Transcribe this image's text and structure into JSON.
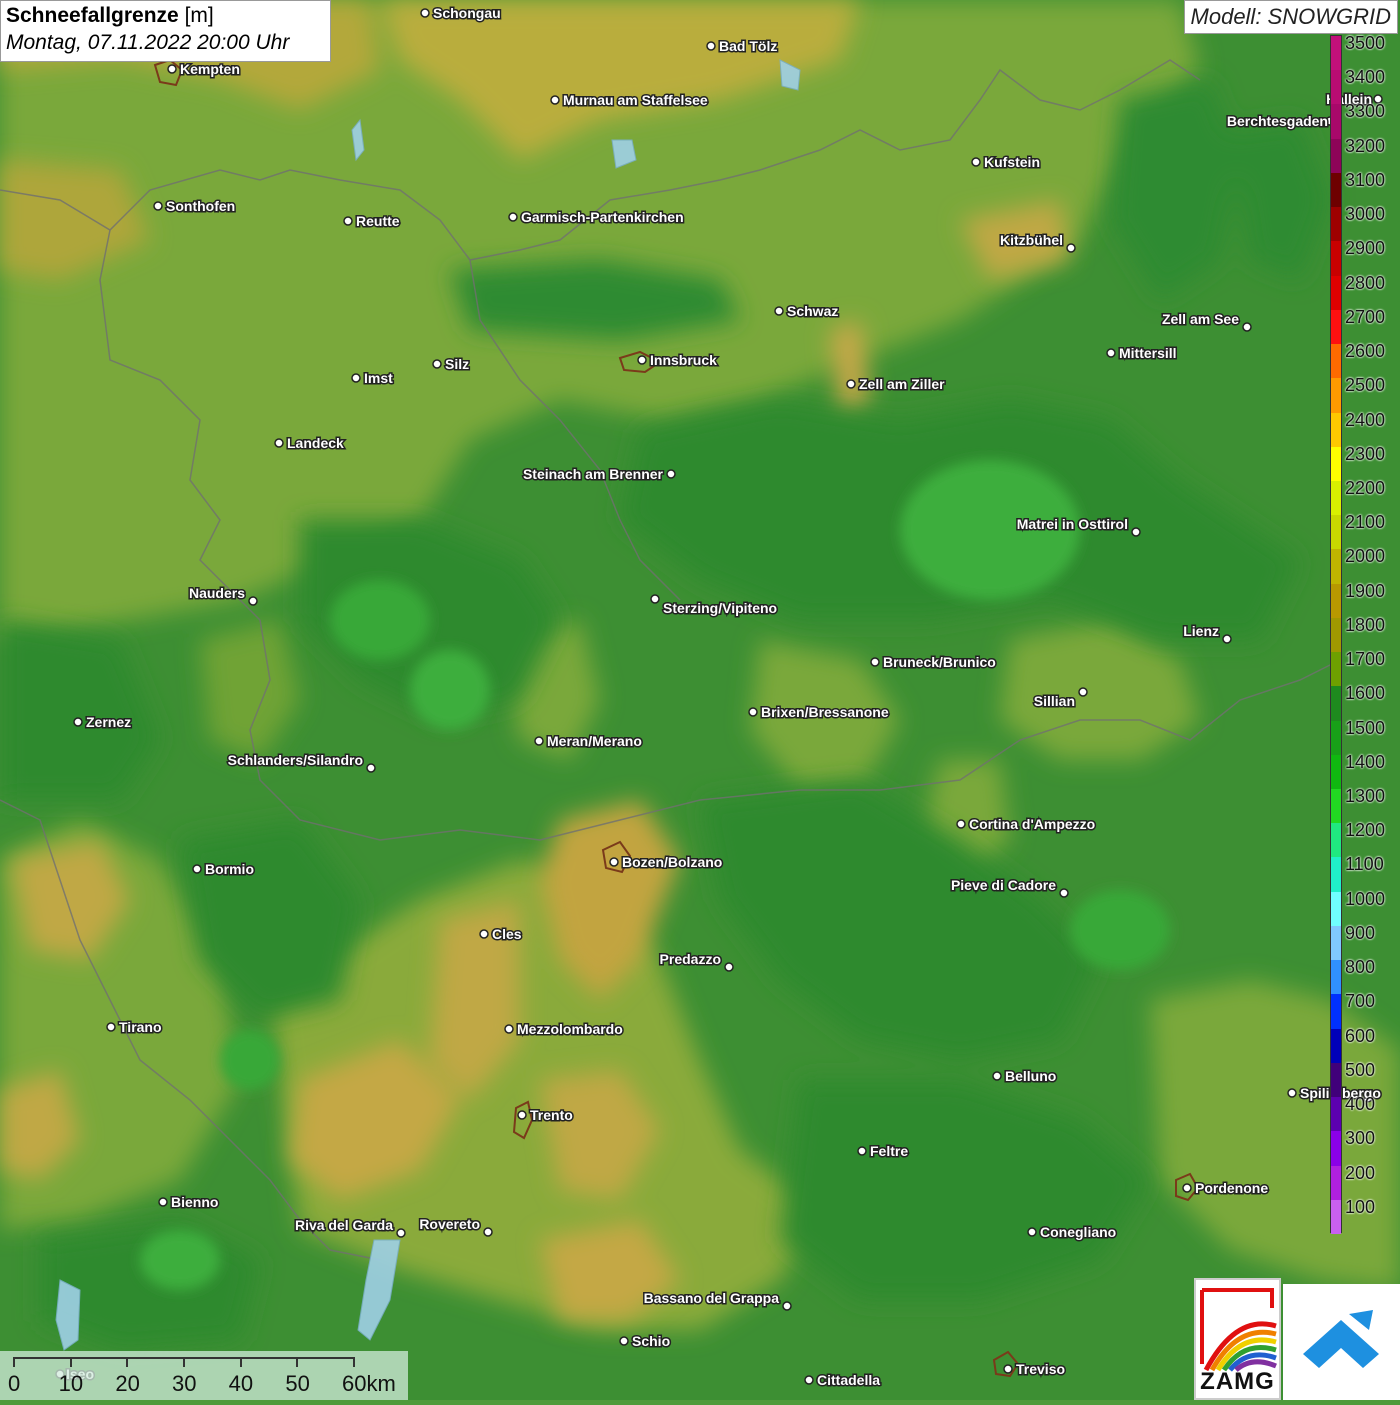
{
  "header": {
    "title": "Schneefallgrenze",
    "unit": "[m]",
    "subtitle": "Montag, 07.11.2022 20:00 Uhr",
    "model": "Modell: SNOWGRID"
  },
  "legend": {
    "items": [
      {
        "label": "3500",
        "color": "#c2107a"
      },
      {
        "label": "3400",
        "color": "#b80c72"
      },
      {
        "label": "3300",
        "color": "#a8086a"
      },
      {
        "label": "3200",
        "color": "#8e0458"
      },
      {
        "label": "3100",
        "color": "#6e0000"
      },
      {
        "label": "3000",
        "color": "#9e0000"
      },
      {
        "label": "2900",
        "color": "#c80000"
      },
      {
        "label": "2800",
        "color": "#e00000"
      },
      {
        "label": "2700",
        "color": "#ff1010"
      },
      {
        "label": "2600",
        "color": "#ff6a00"
      },
      {
        "label": "2500",
        "color": "#ff9a00"
      },
      {
        "label": "2400",
        "color": "#ffc800"
      },
      {
        "label": "2300",
        "color": "#ffff00"
      },
      {
        "label": "2200",
        "color": "#d8f000"
      },
      {
        "label": "2100",
        "color": "#c8d800"
      },
      {
        "label": "2000",
        "color": "#c0b400"
      },
      {
        "label": "1900",
        "color": "#b89800"
      },
      {
        "label": "1800",
        "color": "#a09800"
      },
      {
        "label": "1700",
        "color": "#6ea000"
      },
      {
        "label": "1600",
        "color": "#1e8a1e"
      },
      {
        "label": "1500",
        "color": "#18a018"
      },
      {
        "label": "1400",
        "color": "#10b810"
      },
      {
        "label": "1300",
        "color": "#22d822"
      },
      {
        "label": "1200",
        "color": "#20e880"
      },
      {
        "label": "1100",
        "color": "#20f0c8"
      },
      {
        "label": "1000",
        "color": "#70ffff"
      },
      {
        "label": "900",
        "color": "#80c8ff"
      },
      {
        "label": "800",
        "color": "#3090ff"
      },
      {
        "label": "700",
        "color": "#0030ff"
      },
      {
        "label": "600",
        "color": "#0000b8"
      },
      {
        "label": "500",
        "color": "#40007a"
      },
      {
        "label": "400",
        "color": "#5c00b0"
      },
      {
        "label": "300",
        "color": "#8a00e8"
      },
      {
        "label": "200",
        "color": "#b020e0"
      },
      {
        "label": "100",
        "color": "#c860f0"
      }
    ]
  },
  "scale": {
    "labels": [
      "0",
      "10",
      "20",
      "30",
      "40",
      "50",
      "60km"
    ]
  },
  "cities": [
    {
      "name": "Schongau"
    },
    {
      "name": "Bad Tölz"
    },
    {
      "name": "Kempten"
    },
    {
      "name": "Murnau am Staffelsee"
    },
    {
      "name": "Hallein"
    },
    {
      "name": "Berchtesgaden"
    },
    {
      "name": "Kufstein"
    },
    {
      "name": "Sonthofen"
    },
    {
      "name": "Reutte"
    },
    {
      "name": "Garmisch-Partenkirchen"
    },
    {
      "name": "Kitzbühel"
    },
    {
      "name": "Schwaz"
    },
    {
      "name": "Zell am See"
    },
    {
      "name": "Innsbruck"
    },
    {
      "name": "Mittersill"
    },
    {
      "name": "Imst"
    },
    {
      "name": "Silz"
    },
    {
      "name": "Zell am Ziller"
    },
    {
      "name": "Landeck"
    },
    {
      "name": "Steinach am Brenner"
    },
    {
      "name": "Matrei in Osttirol"
    },
    {
      "name": "Nauders"
    },
    {
      "name": "Sterzing/Vipiteno"
    },
    {
      "name": "Lienz"
    },
    {
      "name": "Bruneck/Brunico"
    },
    {
      "name": "Sillian"
    },
    {
      "name": "Zernez"
    },
    {
      "name": "Brixen/Bressanone"
    },
    {
      "name": "Meran/Merano"
    },
    {
      "name": "Schlanders/Silandro"
    },
    {
      "name": "Cortina d'Ampezzo"
    },
    {
      "name": "Bozen/Bolzano"
    },
    {
      "name": "Bormio"
    },
    {
      "name": "Pieve di Cadore"
    },
    {
      "name": "Cles"
    },
    {
      "name": "Predazzo"
    },
    {
      "name": "Tirano"
    },
    {
      "name": "Mezzolombardo"
    },
    {
      "name": "Belluno"
    },
    {
      "name": "Spilimbergo"
    },
    {
      "name": "Trento"
    },
    {
      "name": "Feltre"
    },
    {
      "name": "Pordenone"
    },
    {
      "name": "Bienno"
    },
    {
      "name": "Riva del Garda"
    },
    {
      "name": "Rovereto"
    },
    {
      "name": "Conegliano"
    },
    {
      "name": "Bassano del Grappa"
    },
    {
      "name": "Schio"
    },
    {
      "name": "Treviso"
    },
    {
      "name": "Cittadella"
    },
    {
      "name": "Iseo"
    }
  ],
  "logos": {
    "zamg": "ZAMG"
  }
}
